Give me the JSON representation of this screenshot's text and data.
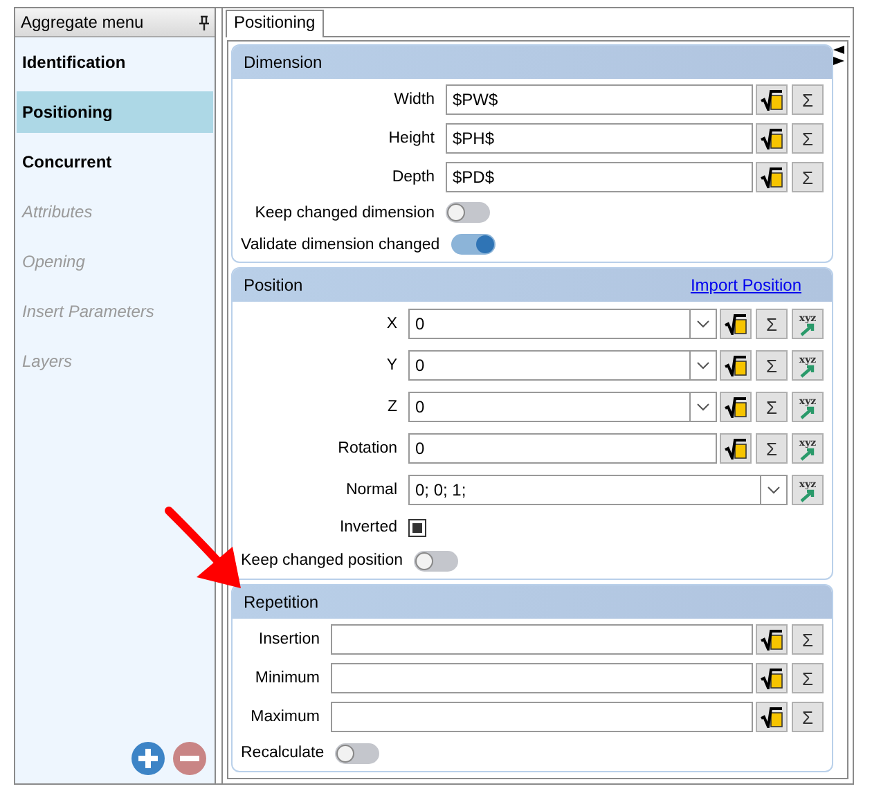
{
  "sidebar": {
    "title": "Aggregate menu",
    "items": [
      {
        "label": "Identification",
        "selected": false,
        "disabled": false
      },
      {
        "label": "Positioning",
        "selected": true,
        "disabled": false
      },
      {
        "label": "Concurrent",
        "selected": false,
        "disabled": false
      },
      {
        "label": "Attributes",
        "selected": false,
        "disabled": true
      },
      {
        "label": "Opening",
        "selected": false,
        "disabled": true
      },
      {
        "label": "Insert Parameters",
        "selected": false,
        "disabled": true
      },
      {
        "label": "Layers",
        "selected": false,
        "disabled": true
      }
    ]
  },
  "tabs": [
    {
      "label": "Positioning",
      "selected": true
    }
  ],
  "groups": [
    {
      "title": "Dimension",
      "rows": [
        {
          "kind": "field",
          "label": "Width",
          "value": "$PW$",
          "dropdown": false,
          "buttons": [
            {
              "kind": "formula"
            },
            {
              "kind": "sum",
              "label": "Σ"
            }
          ]
        },
        {
          "kind": "field",
          "label": "Height",
          "value": "$PH$",
          "dropdown": false,
          "buttons": [
            {
              "kind": "formula"
            },
            {
              "kind": "sum",
              "label": "Σ"
            }
          ]
        },
        {
          "kind": "field",
          "label": "Depth",
          "value": "$PD$",
          "dropdown": false,
          "buttons": [
            {
              "kind": "formula"
            },
            {
              "kind": "sum",
              "label": "Σ"
            }
          ]
        },
        {
          "kind": "toggle",
          "label": "Keep changed dimension",
          "on": false
        },
        {
          "kind": "toggle",
          "label": "Validate dimension changed",
          "on": true
        }
      ]
    },
    {
      "title": "Position",
      "link": "Import Position",
      "rows": [
        {
          "kind": "field",
          "label": "X",
          "value": "0",
          "dropdown": true,
          "buttons": [
            {
              "kind": "formula"
            },
            {
              "kind": "sum",
              "label": "Σ"
            },
            {
              "kind": "xyz",
              "label": "xyz"
            }
          ]
        },
        {
          "kind": "field",
          "label": "Y",
          "value": "0",
          "dropdown": true,
          "buttons": [
            {
              "kind": "formula"
            },
            {
              "kind": "sum",
              "label": "Σ"
            },
            {
              "kind": "xyz",
              "label": "xyz"
            }
          ]
        },
        {
          "kind": "field",
          "label": "Z",
          "value": "0",
          "dropdown": true,
          "buttons": [
            {
              "kind": "formula"
            },
            {
              "kind": "sum",
              "label": "Σ"
            },
            {
              "kind": "xyz",
              "label": "xyz"
            }
          ]
        },
        {
          "kind": "field",
          "label": "Rotation",
          "value": "0",
          "dropdown": false,
          "buttons": [
            {
              "kind": "formula"
            },
            {
              "kind": "sum",
              "label": "Σ"
            },
            {
              "kind": "xyz",
              "label": "xyz"
            }
          ]
        },
        {
          "kind": "field",
          "label": "Normal",
          "value": "0; 0; 1;",
          "dropdown": true,
          "buttons": [
            {
              "kind": "xyz",
              "label": "xyz"
            }
          ]
        },
        {
          "kind": "checkbox",
          "label": "Inverted",
          "checked": true
        },
        {
          "kind": "toggle",
          "label": "Keep changed position",
          "on": false
        }
      ]
    },
    {
      "title": "Repetition",
      "rows": [
        {
          "kind": "field",
          "label": "Insertion",
          "dropdown": false,
          "buttons": [
            {
              "kind": "formula"
            },
            {
              "kind": "sum",
              "label": "Σ"
            }
          ]
        },
        {
          "kind": "field",
          "label": "Minimum",
          "dropdown": false,
          "buttons": [
            {
              "kind": "formula"
            },
            {
              "kind": "sum",
              "label": "Σ"
            }
          ]
        },
        {
          "kind": "field",
          "label": "Maximum",
          "dropdown": false,
          "buttons": [
            {
              "kind": "formula"
            },
            {
              "kind": "sum",
              "label": "Σ"
            }
          ]
        },
        {
          "kind": "toggle",
          "label": "Recalculate",
          "on": false
        }
      ]
    }
  ]
}
